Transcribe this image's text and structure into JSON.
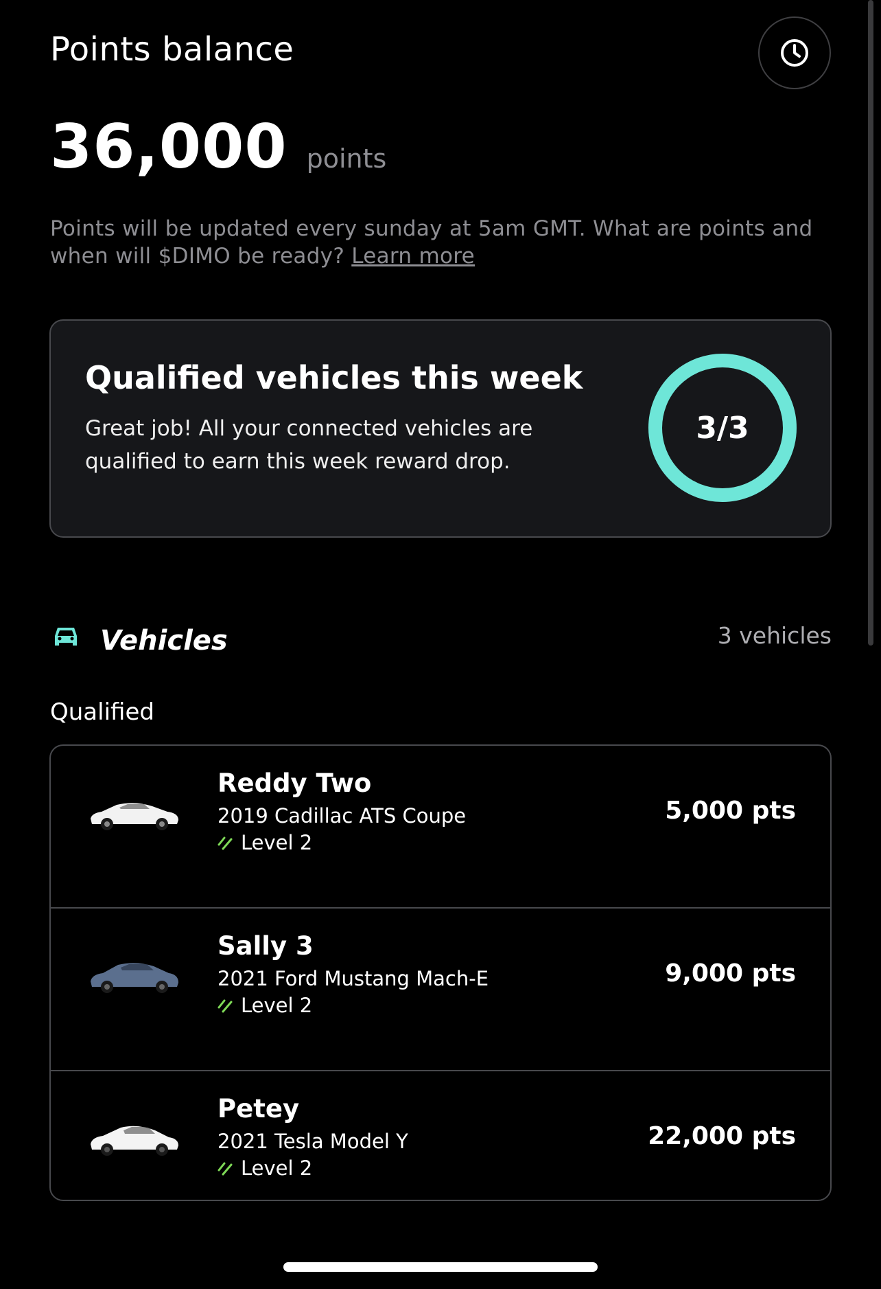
{
  "header": {
    "title": "Points balance",
    "history_icon": "clock-icon"
  },
  "balance": {
    "value": "36,000",
    "unit": "points"
  },
  "info": {
    "text": "Points will be updated every sunday at 5am GMT. What are points and when will $DIMO be ready? ",
    "link_label": "Learn more"
  },
  "qualified_card": {
    "title": "Qualified vehicles this week",
    "description": "Great job! All your connected vehicles are qualified to earn this week reward drop.",
    "qualified": 3,
    "total": 3,
    "ring_label": "3/3",
    "ring_color": "#6ee6d8"
  },
  "vehicles": {
    "title": "Vehicles",
    "count_label": "3 vehicles",
    "icon": "car-icon",
    "icon_color": "#6ee6d8",
    "section_label": "Qualified",
    "items": [
      {
        "name": "Reddy Two",
        "model": "2019 Cadillac ATS Coupe",
        "level": "Level 2",
        "points": "5,000 pts",
        "car_color": "#f2f2f2"
      },
      {
        "name": "Sally 3",
        "model": "2021 Ford Mustang Mach-E",
        "level": "Level 2",
        "points": "9,000 pts",
        "car_color": "#5b6f8e"
      },
      {
        "name": "Petey",
        "model": "2021 Tesla Model Y",
        "level": "Level 2",
        "points": "22,000 pts",
        "car_color": "#f4f4f4"
      }
    ],
    "level_icon_color": "#7ed957"
  }
}
